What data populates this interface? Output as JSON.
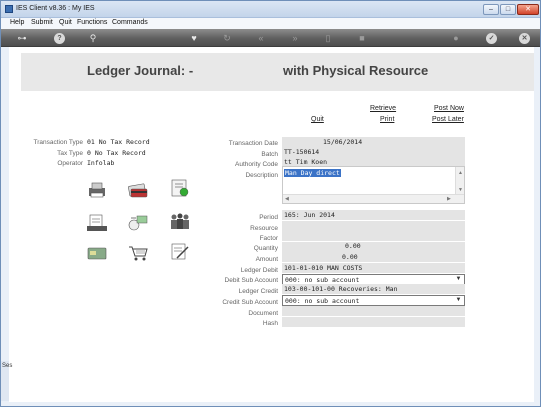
{
  "window": {
    "title": "IES Client v8.36 : My IES"
  },
  "menu": [
    "Help",
    "Submit",
    "Quit",
    "Functions",
    "Commands"
  ],
  "page": {
    "title_left": "Ledger Journal: -",
    "title_right": "with Physical Resource"
  },
  "actions": {
    "quit": "Quit",
    "retrieve": "Retrieve",
    "print": "Print",
    "post_now": "Post Now",
    "post_later": "Post Later"
  },
  "info": {
    "transaction_type_label": "Transaction Type",
    "transaction_type": "01 No Tax Record",
    "tax_type_label": "Tax Type",
    "tax_type": "0 No Tax Record",
    "operator_label": "Operator",
    "operator": "Infolab"
  },
  "form": {
    "transaction_date_label": "Transaction Date",
    "transaction_date": "15/06/2014",
    "batch_label": "Batch",
    "batch": "TT-150614",
    "authority_code_label": "Authority Code",
    "authority_code": "tt Tim Koen",
    "description_label": "Description",
    "description": "Man Day direct",
    "period_label": "Period",
    "period": "165: Jun 2014",
    "resource_label": "Resource",
    "factor_label": "Factor",
    "quantity_label": "Quantity",
    "quantity": "0.00",
    "amount_label": "Amount",
    "amount": "0.00",
    "ledger_debit_label": "Ledger Debit",
    "ledger_debit": "101-01-010 MAN COSTS",
    "debit_sub_account_label": "Debit Sub Account",
    "debit_sub_account": "000: no sub account",
    "ledger_credit_label": "Ledger Credit",
    "ledger_credit": "103-00-101-00 Recoveries: Man",
    "credit_sub_account_label": "Credit Sub Account",
    "credit_sub_account": "000: no sub account",
    "document_label": "Document",
    "hash_label": "Hash"
  },
  "side_strip": {
    "label": "Ses"
  },
  "colors": {
    "accent": "#3b73c7",
    "toolbar": "#5f5f5f",
    "field": "#e4e4e4"
  }
}
